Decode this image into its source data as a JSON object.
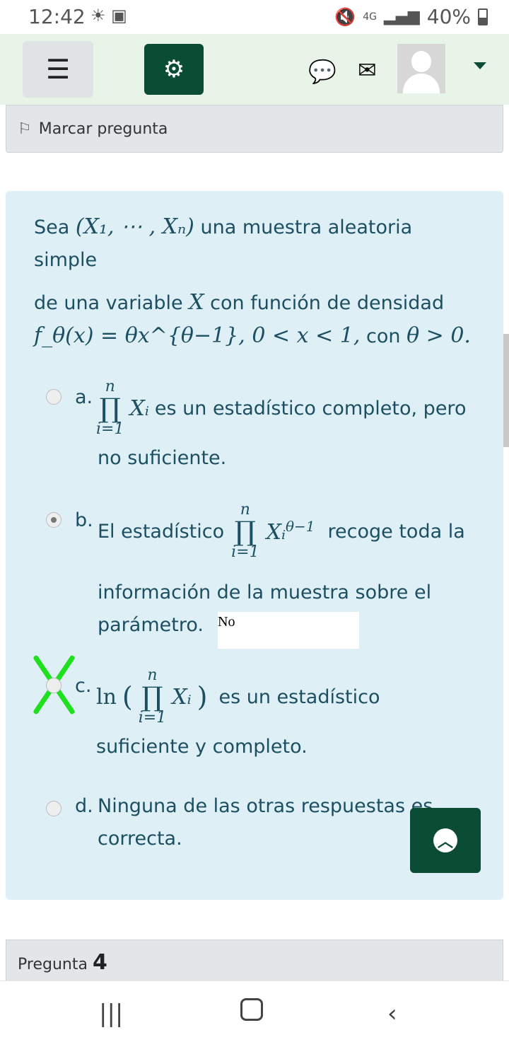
{
  "statusbar": {
    "time": "12:42",
    "left_icons": "weather-icon image-icon",
    "network": "4G",
    "battery": "40%"
  },
  "navbar": {
    "menu_icon": "hamburger-icon",
    "settings_icon": "gears-icon",
    "chat_icon": "chat-bubble-icon",
    "mail_icon": "envelope-icon",
    "user_menu_icon": "chevron-down-icon"
  },
  "flag": {
    "label": "Marcar pregunta",
    "icon": "flag-icon"
  },
  "question": {
    "line1_pre": "Sea ",
    "line1_math": "(X₁, ⋯ , Xₙ)",
    "line1_post": " una muestra aleatoria simple",
    "line2_pre": "de  una variable ",
    "line2_math": "X",
    "line2_post": " con función de densidad",
    "line3_math": "f_θ(x) = θx^{θ−1}, 0 < x < 1,",
    "line3_mid": " con ",
    "line3_math2": "θ > 0."
  },
  "options": [
    {
      "letter": "a.",
      "text": "es un estadístico completo, pero",
      "text2": "no suficiente.",
      "selected": false
    },
    {
      "letter": "b.",
      "pre": "El estadístico",
      "text": "recoge toda la",
      "text2": "información de la muestra sobre el",
      "text3": "parámetro.",
      "selected": true,
      "feedback": "No"
    },
    {
      "letter": "c.",
      "text": "es un estadístico",
      "text2": "suficiente y completo.",
      "selected": false,
      "marked_wrong": true
    },
    {
      "letter": "d.",
      "text": "Ninguna de las otras respuestas es",
      "text2": "correcta.",
      "selected": false
    }
  ],
  "math": {
    "prod_top": "n",
    "prod_bottom": "i=1",
    "prod_symbol": "∏",
    "Xi": "Xᵢ",
    "exp": "θ−1",
    "ln": "ln"
  },
  "up_button_icon": "chevron-up-icon",
  "next_question": {
    "label": "Pregunta",
    "number": "4"
  },
  "colors": {
    "accent": "#0a4d34",
    "card": "#def0f5",
    "wrong_mark": "#1ee01e"
  }
}
